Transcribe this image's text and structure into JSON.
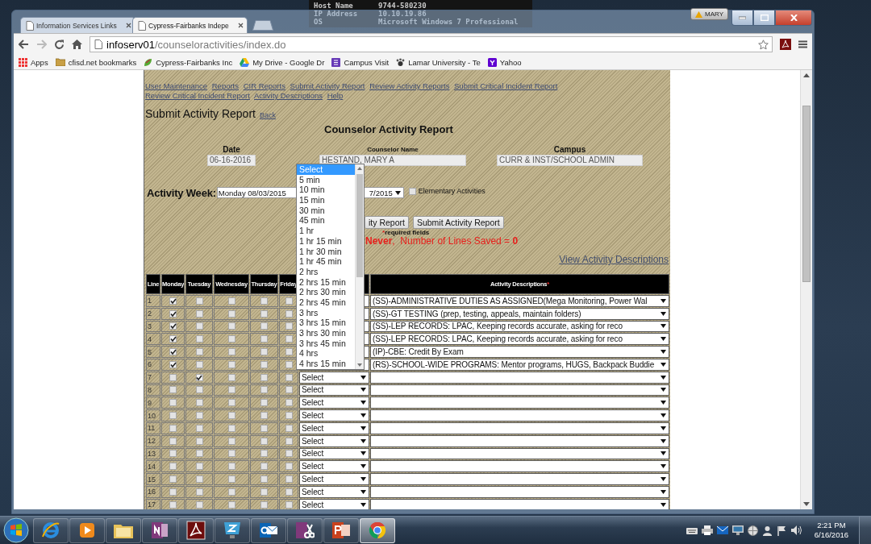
{
  "desktop_info": [
    {
      "label": "Host Name",
      "value": "9744-580230"
    },
    {
      "label": "IP Address",
      "value": "10.10.19.86"
    },
    {
      "label": "OS",
      "value": "Microsoft Windows 7 Professional"
    }
  ],
  "browser": {
    "tabs": [
      {
        "title": "Information Services Links",
        "selected": false
      },
      {
        "title": "Cypress-Fairbanks Indepe",
        "selected": true
      }
    ],
    "user": "MARY",
    "address": {
      "host": "infoserv01",
      "path": "/counseloractivities/index.do"
    },
    "bookmarks": [
      {
        "label": "Apps",
        "kind": "apps"
      },
      {
        "label": "cfisd.net bookmarks",
        "kind": "folder"
      },
      {
        "label": "Cypress-Fairbanks Inc",
        "kind": "site"
      },
      {
        "label": "My Drive - Google Dr",
        "kind": "drive"
      },
      {
        "label": "Campus Visit",
        "kind": "form"
      },
      {
        "label": "Lamar University - Te",
        "kind": "paw"
      },
      {
        "label": "Yahoo",
        "kind": "yahoo"
      }
    ]
  },
  "nav_links": [
    "User Maintenance",
    "Reports",
    "CIR Reports",
    "Submit Activity Report",
    "Review Activity Reports",
    "Submit Critical Incident Report",
    "Review Critical Incident Report",
    "Activity Descriptions",
    "Help"
  ],
  "page_title": "Submit Activity Report",
  "back_link": "Back",
  "heading": "Counselor Activity Report",
  "fields": [
    {
      "label": "Date",
      "value": "06-16-2016"
    },
    {
      "label": "Counselor Name",
      "value": "HESTAND, MARY A"
    },
    {
      "label": "Campus",
      "value": "CURR & INST/SCHOOL ADMIN"
    }
  ],
  "activity_week": {
    "label": "Activity Week:",
    "value_start": "Monday 08/03/2015",
    "value_end": "7/2015"
  },
  "elementary": {
    "label": "Elementary Activities",
    "checked": false
  },
  "buttons": [
    "ity Report",
    "Submit Activity Report"
  ],
  "required_mark": "*",
  "required_note": "required fields",
  "status": "**Never**,  Number of Lines Saved = **0**",
  "view_link": "View Activity Descriptions",
  "table": {
    "columns": [
      "Line",
      "Monday",
      "Tuesday",
      "Wednesday",
      "Thursday",
      "Friday"
    ],
    "activity_column": "Activity Descriptions",
    "activity_mark": "*",
    "rows": [
      {
        "line": "1",
        "days": [
          true,
          false,
          false,
          false,
          false
        ],
        "activity": "(SS)-ADMINISTRATIVE DUTIES AS ASSIGNED(Mega Monitoring, Power Wal"
      },
      {
        "line": "2",
        "days": [
          true,
          false,
          false,
          false,
          false
        ],
        "activity": "(SS)-GT TESTING (prep, testing, appeals, maintain folders)"
      },
      {
        "line": "3",
        "days": [
          true,
          false,
          false,
          false,
          false
        ],
        "activity": "(SS)-LEP RECORDS: LPAC, Keeping records accurate, asking for reco"
      },
      {
        "line": "4",
        "days": [
          true,
          false,
          false,
          false,
          false
        ],
        "activity": "(SS)-LEP RECORDS: LPAC, Keeping records accurate, asking for reco"
      },
      {
        "line": "5",
        "days": [
          true,
          false,
          false,
          false,
          false
        ],
        "activity": "(IP)-CBE: Credit By Exam"
      },
      {
        "line": "6",
        "days": [
          true,
          false,
          false,
          false,
          false
        ],
        "activity": "(RS)-SCHOOL-WIDE PROGRAMS: Mentor programs, HUGS, Backpack Buddie"
      },
      {
        "line": "7",
        "days": [
          false,
          true,
          false,
          false,
          false
        ],
        "time": "Select"
      },
      {
        "line": "8",
        "days": [
          false,
          false,
          false,
          false,
          false
        ],
        "time": "Select"
      },
      {
        "line": "9",
        "days": [
          false,
          false,
          false,
          false,
          false
        ],
        "time": "Select"
      },
      {
        "line": "10",
        "days": [
          false,
          false,
          false,
          false,
          false
        ],
        "time": "Select"
      },
      {
        "line": "11",
        "days": [
          false,
          false,
          false,
          false,
          false
        ],
        "time": "Select"
      },
      {
        "line": "12",
        "days": [
          false,
          false,
          false,
          false,
          false
        ],
        "time": "Select"
      },
      {
        "line": "13",
        "days": [
          false,
          false,
          false,
          false,
          false
        ],
        "time": "Select"
      },
      {
        "line": "14",
        "days": [
          false,
          false,
          false,
          false,
          false
        ],
        "time": "Select"
      },
      {
        "line": "15",
        "days": [
          false,
          false,
          false,
          false,
          false
        ],
        "time": "Select"
      },
      {
        "line": "16",
        "days": [
          false,
          false,
          false,
          false,
          false
        ],
        "time": "Select"
      },
      {
        "line": "17",
        "days": [
          false,
          false,
          false,
          false,
          false
        ],
        "time": "Select"
      }
    ]
  },
  "time_dropdown": {
    "options": [
      {
        "label": "Select",
        "selected": true
      },
      {
        "label": "5 min",
        "selected": false
      },
      {
        "label": "10 min",
        "selected": false
      },
      {
        "label": "15 min",
        "selected": false
      },
      {
        "label": "30 min",
        "selected": false
      },
      {
        "label": "45 min",
        "selected": false
      },
      {
        "label": "1 hr",
        "selected": false
      },
      {
        "label": "1 hr 15 min",
        "selected": false
      },
      {
        "label": "1 hr 30 min",
        "selected": false
      },
      {
        "label": "1 hr 45 min",
        "selected": false
      },
      {
        "label": "2 hrs",
        "selected": false
      },
      {
        "label": "2 hrs 15 min",
        "selected": false
      },
      {
        "label": "2 hrs 30 min",
        "selected": false
      },
      {
        "label": "2 hrs 45 min",
        "selected": false
      },
      {
        "label": "3 hrs",
        "selected": false
      },
      {
        "label": "3 hrs 15 min",
        "selected": false
      },
      {
        "label": "3 hrs 30 min",
        "selected": false
      },
      {
        "label": "3 hrs 45 min",
        "selected": false
      },
      {
        "label": "4 hrs",
        "selected": false
      },
      {
        "label": "4 hrs 15 min",
        "selected": false
      }
    ]
  },
  "taskbar": {
    "apps": [
      {
        "kind": "ie",
        "selected": false
      },
      {
        "kind": "media",
        "selected": false
      },
      {
        "kind": "explorer",
        "selected": false
      },
      {
        "kind": "notebook",
        "selected": false
      },
      {
        "kind": "pdf",
        "selected": false
      },
      {
        "kind": "monitor",
        "selected": false
      },
      {
        "kind": "mail",
        "selected": false
      },
      {
        "kind": "clipper",
        "selected": false
      },
      {
        "kind": "slides",
        "selected": false
      },
      {
        "kind": "chrome",
        "selected": true
      }
    ],
    "time": "2:21 PM",
    "date": "6/16/2016"
  }
}
